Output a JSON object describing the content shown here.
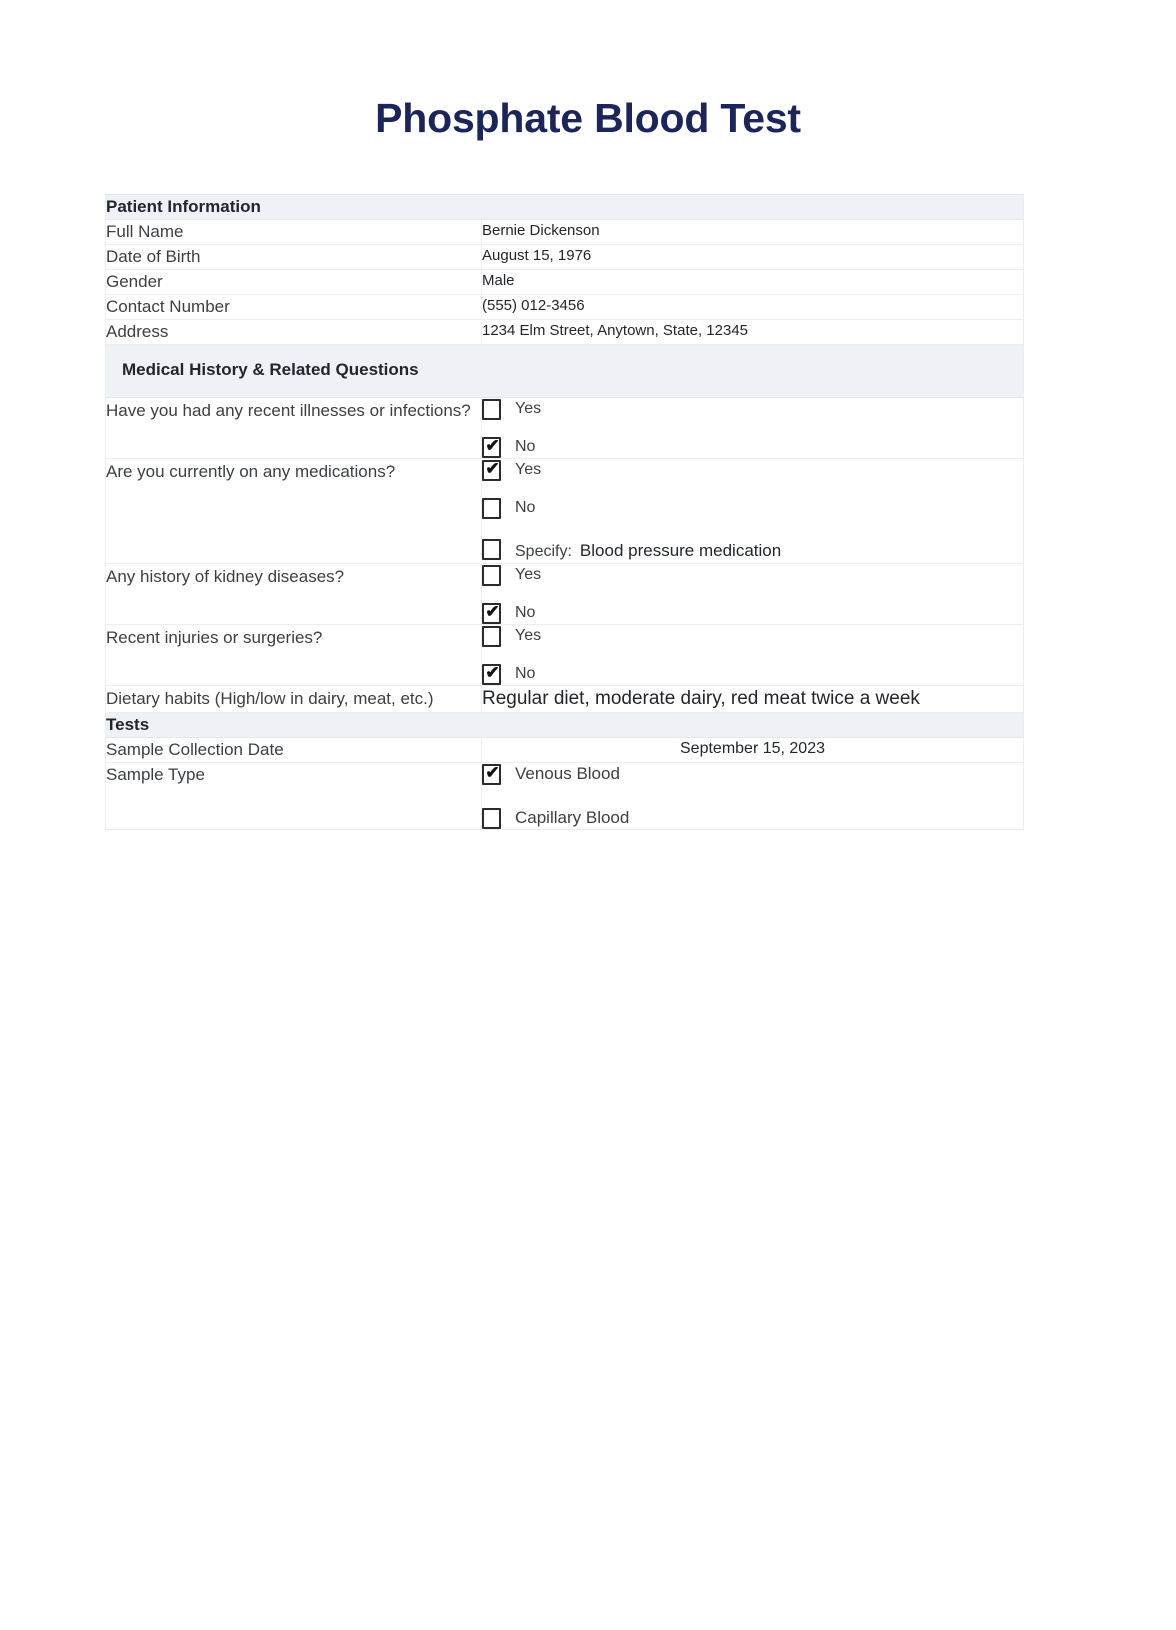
{
  "document": {
    "title": "Phosphate Blood Test"
  },
  "colors": {
    "title": "#1b2559",
    "section_header_bg": "#eef1f5",
    "border": "#eceef1",
    "text": "#3c4043"
  },
  "sections": {
    "patient_information": {
      "heading": "Patient Information",
      "fields": [
        {
          "label": "Full Name",
          "value": "Bernie Dickenson"
        },
        {
          "label": "Date of Birth",
          "value": "August 15, 1976"
        },
        {
          "label": "Gender",
          "value": "Male"
        },
        {
          "label": "Contact Number",
          "value": "(555) 012-3456"
        },
        {
          "label": "Address",
          "value": "1234 Elm Street, Anytown, State, 12345"
        }
      ]
    },
    "medical_history": {
      "heading": "Medical History & Related Questions",
      "questions": [
        {
          "label": "Have you had any recent illnesses or infections?",
          "options": [
            {
              "label": "Yes",
              "checked": false
            },
            {
              "label": "No",
              "checked": true
            }
          ]
        },
        {
          "label": "Are you currently on any medications?",
          "options": [
            {
              "label": "Yes",
              "checked": true
            },
            {
              "label": "No",
              "checked": false
            }
          ],
          "specify": {
            "label": "Specify:",
            "checked": false,
            "value": "Blood pressure medication"
          }
        },
        {
          "label": "Any history of kidney diseases?",
          "options": [
            {
              "label": "Yes",
              "checked": false
            },
            {
              "label": "No",
              "checked": true
            }
          ]
        },
        {
          "label": "Recent injuries or surgeries?",
          "options": [
            {
              "label": "Yes",
              "checked": false
            },
            {
              "label": "No",
              "checked": true
            }
          ]
        }
      ],
      "dietary": {
        "label": "Dietary habits (High/low in dairy, meat, etc.)",
        "value": "Regular diet, moderate dairy, red meat twice a week"
      }
    },
    "tests": {
      "heading": "Tests",
      "sample_collection_date": {
        "label": "Sample Collection Date",
        "value": "September 15, 2023"
      },
      "sample_type": {
        "label": "Sample Type",
        "options": [
          {
            "label": "Venous Blood",
            "checked": true
          },
          {
            "label": "Capillary Blood",
            "checked": false
          }
        ]
      }
    }
  },
  "icons": {
    "checkmark": "✔"
  }
}
